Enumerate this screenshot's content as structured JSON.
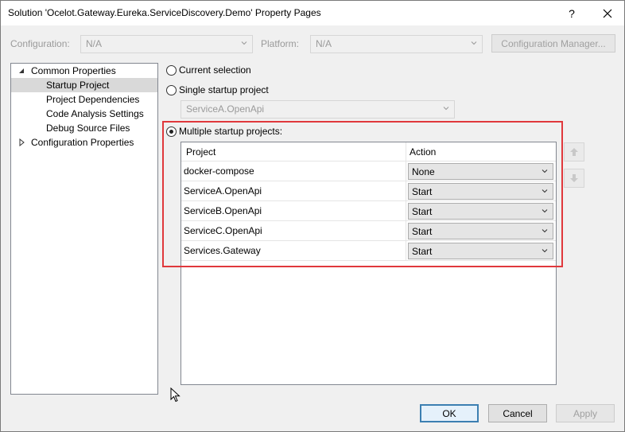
{
  "window": {
    "title": "Solution 'Ocelot.Gateway.Eureka.ServiceDiscovery.Demo' Property Pages",
    "help_label": "?",
    "close_icon": "close-icon"
  },
  "toolbar": {
    "configuration_label": "Configuration:",
    "configuration_value": "N/A",
    "platform_label": "Platform:",
    "platform_value": "N/A",
    "config_manager_label": "Configuration Manager..."
  },
  "tree": {
    "items": [
      {
        "label": "Common Properties",
        "expanded": true
      },
      {
        "label": "Startup Project",
        "selected": true
      },
      {
        "label": "Project Dependencies"
      },
      {
        "label": "Code Analysis Settings"
      },
      {
        "label": "Debug Source Files"
      },
      {
        "label": "Configuration Properties",
        "expanded": false
      }
    ]
  },
  "startup": {
    "current_selection_label": "Current selection",
    "single_label": "Single startup project",
    "single_value": "ServiceA.OpenApi",
    "multiple_label": "Multiple startup projects:",
    "selected_option": "multiple"
  },
  "grid": {
    "headers": [
      "Project",
      "Action"
    ],
    "rows": [
      {
        "project": "docker-compose",
        "action": "None"
      },
      {
        "project": "ServiceA.OpenApi",
        "action": "Start"
      },
      {
        "project": "ServiceB.OpenApi",
        "action": "Start"
      },
      {
        "project": "ServiceC.OpenApi",
        "action": "Start"
      },
      {
        "project": "Services.Gateway",
        "action": "Start"
      }
    ]
  },
  "buttons": {
    "ok": "OK",
    "cancel": "Cancel",
    "apply": "Apply"
  },
  "colors": {
    "highlight": "#e0383c",
    "selection": "#d9d9d9",
    "ok_border": "#3c7fb1"
  }
}
